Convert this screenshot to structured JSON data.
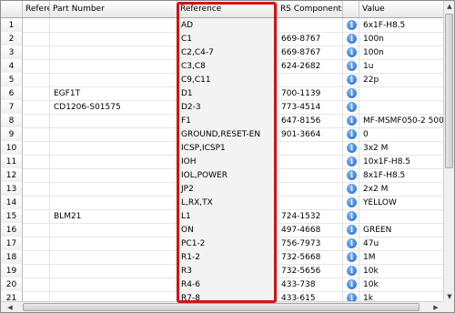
{
  "columns": {
    "row_num": "",
    "reference_short": "Referer",
    "part_number": "Part Number",
    "reference": "Reference",
    "rs_components": "RS Components Par",
    "value": "Value"
  },
  "rows": [
    {
      "n": "1",
      "part": "",
      "reference": "AD",
      "rs": "",
      "value": "6x1F-H8.5"
    },
    {
      "n": "2",
      "part": "",
      "reference": "C1",
      "rs": "669-8767",
      "value": "100n"
    },
    {
      "n": "3",
      "part": "",
      "reference": "C2,C4-7",
      "rs": "669-8767",
      "value": "100n"
    },
    {
      "n": "4",
      "part": "",
      "reference": "C3,C8",
      "rs": "624-2682",
      "value": "1u"
    },
    {
      "n": "5",
      "part": "",
      "reference": "C9,C11",
      "rs": "",
      "value": "22p"
    },
    {
      "n": "6",
      "part": "EGF1T",
      "reference": "D1",
      "rs": "700-1139",
      "value": ""
    },
    {
      "n": "7",
      "part": "CD1206-S01575",
      "reference": "D2-3",
      "rs": "773-4514",
      "value": ""
    },
    {
      "n": "8",
      "part": "",
      "reference": "F1",
      "rs": "647-8156",
      "value": "MF-MSMF050-2 500"
    },
    {
      "n": "9",
      "part": "",
      "reference": "GROUND,RESET-EN",
      "rs": "901-3664",
      "value": "0"
    },
    {
      "n": "10",
      "part": "",
      "reference": "ICSP,ICSP1",
      "rs": "",
      "value": "3x2 M"
    },
    {
      "n": "11",
      "part": "",
      "reference": "IOH",
      "rs": "",
      "value": "10x1F-H8.5"
    },
    {
      "n": "12",
      "part": "",
      "reference": "IOL,POWER",
      "rs": "",
      "value": "8x1F-H8.5"
    },
    {
      "n": "13",
      "part": "",
      "reference": "JP2",
      "rs": "",
      "value": "2x2 M"
    },
    {
      "n": "14",
      "part": "",
      "reference": "L,RX,TX",
      "rs": "",
      "value": "YELLOW"
    },
    {
      "n": "15",
      "part": "BLM21",
      "reference": "L1",
      "rs": "724-1532",
      "value": ""
    },
    {
      "n": "16",
      "part": "",
      "reference": "ON",
      "rs": "497-4668",
      "value": "GREEN"
    },
    {
      "n": "17",
      "part": "",
      "reference": "PC1-2",
      "rs": "756-7973",
      "value": "47u"
    },
    {
      "n": "18",
      "part": "",
      "reference": "R1-2",
      "rs": "732-5668",
      "value": "1M"
    },
    {
      "n": "19",
      "part": "",
      "reference": "R3",
      "rs": "732-5656",
      "value": "10k"
    },
    {
      "n": "20",
      "part": "",
      "reference": "R4-6",
      "rs": "433-738",
      "value": "10k"
    },
    {
      "n": "21",
      "part": "",
      "reference": "R7-8",
      "rs": "433-615",
      "value": "1k"
    }
  ],
  "info_icon": "info-icon",
  "highlight_color": "#d21414"
}
